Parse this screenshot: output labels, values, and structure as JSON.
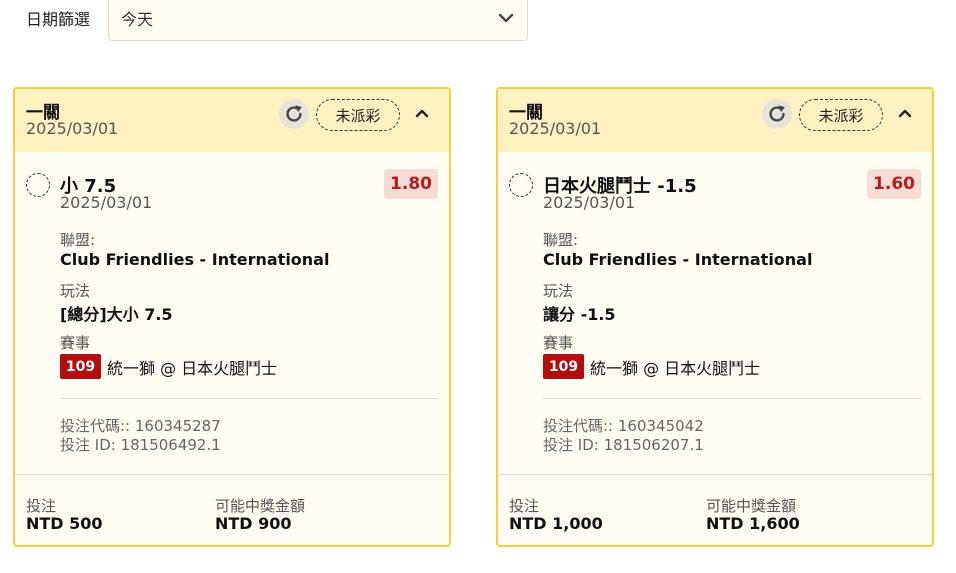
{
  "filter": {
    "label": "日期篩選",
    "value": "今天"
  },
  "cards": [
    {
      "title": "一關",
      "date": "2025/03/01",
      "status": "未派彩",
      "selection": "小 7.5",
      "selection_date": "2025/03/01",
      "odds": "1.80",
      "league_label": "聯盟:",
      "league": "Club Friendlies - International",
      "play_label": "玩法",
      "play": "[總分]大小 7.5",
      "match_label": "賽事",
      "match_no": "109",
      "match": "統一獅 @ 日本火腿鬥士",
      "bet_code": "投注代碼:: 160345287",
      "bet_id": "投注 ID: 181506492.1",
      "stake_label": "投注",
      "stake": "NTD 500",
      "payout_label": "可能中獎金額",
      "payout": "NTD 900"
    },
    {
      "title": "一關",
      "date": "2025/03/01",
      "status": "未派彩",
      "selection": "日本火腿鬥士 -1.5",
      "selection_date": "2025/03/01",
      "odds": "1.60",
      "league_label": "聯盟:",
      "league": "Club Friendlies - International",
      "play_label": "玩法",
      "play": "讓分 -1.5",
      "match_label": "賽事",
      "match_no": "109",
      "match": "統一獅 @ 日本火腿鬥士",
      "bet_code": "投注代碼:: 160345042",
      "bet_id": "投注 ID: 181506207.1",
      "stake_label": "投注",
      "stake": "NTD 1,000",
      "payout_label": "可能中獎金額",
      "payout": "NTD 1,600"
    }
  ]
}
